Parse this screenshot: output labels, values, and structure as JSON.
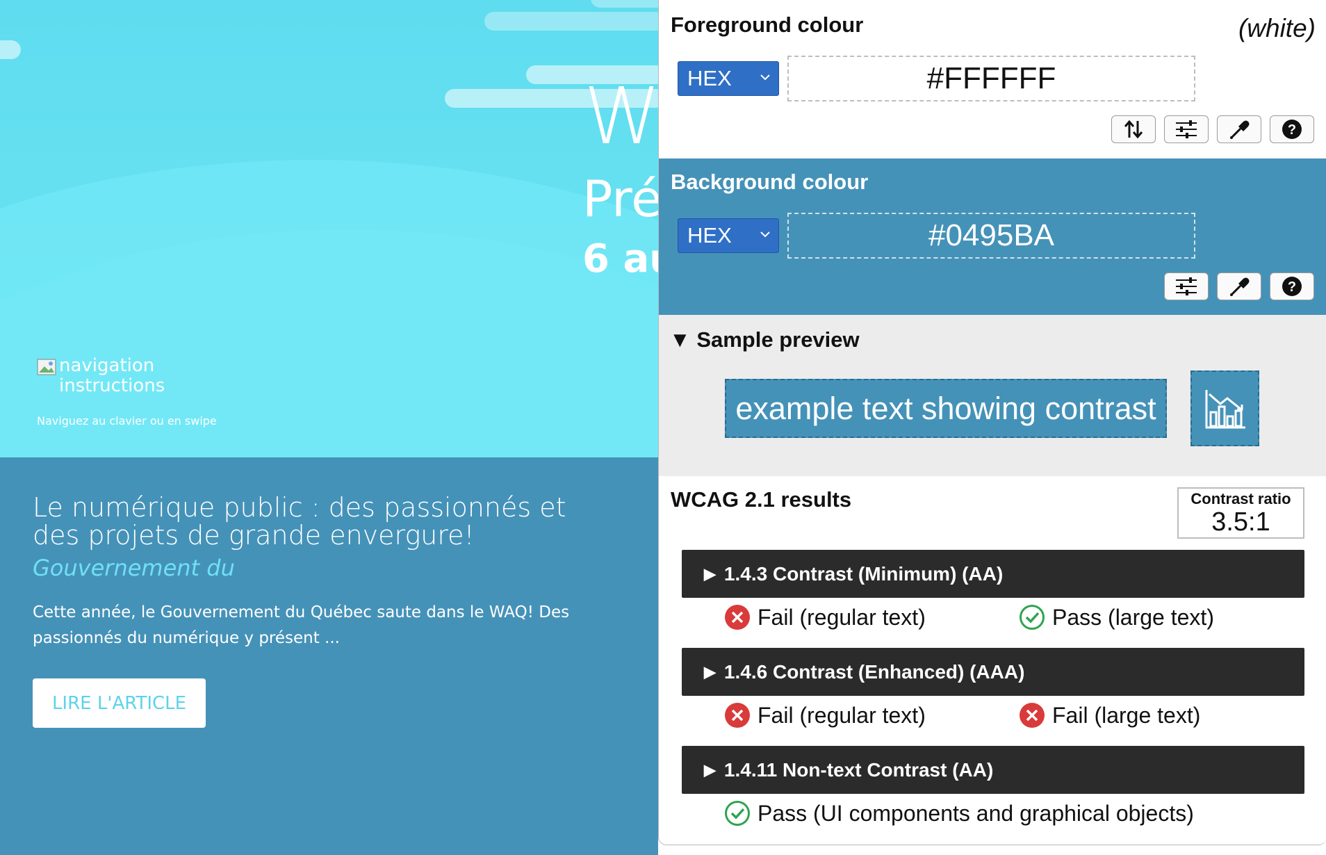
{
  "webpage": {
    "hero": {
      "title_fragment": "W",
      "subtitle_fragment": "Pré",
      "date_fragment": "6 au"
    },
    "nav_image_alt": "navigation instructions",
    "nav_hint": "Naviguez au clavier ou en swipe",
    "article": {
      "title": "Le numérique public : des passionnés et des projets de grande envergure!",
      "source": "Gouvernement du",
      "excerpt": "Cette année, le Gouvernement du Québec saute dans le WAQ! Des passionnés du numérique y présent ...",
      "button": "LIRE L'ARTICLE"
    },
    "colors": {
      "hero": "#66E2F2",
      "article_bg": "#4592B8",
      "accent": "#5CD3EA"
    }
  },
  "panel": {
    "foreground": {
      "heading": "Foreground colour",
      "name": "(white)",
      "format": "HEX",
      "value": "#FFFFFF",
      "tools": [
        "swap-icon",
        "sliders-icon",
        "eyedropper-icon",
        "help-icon"
      ]
    },
    "background": {
      "heading": "Background colour",
      "format": "HEX",
      "value": "#0495BA",
      "tools": [
        "sliders-icon",
        "eyedropper-icon",
        "help-icon"
      ]
    },
    "preview": {
      "heading": "Sample preview",
      "sample_text": "example text showing contrast",
      "graphic_icon": "chart-icon"
    },
    "results": {
      "heading": "WCAG 2.1 results",
      "ratio_label": "Contrast ratio",
      "ratio_value": "3.5:1",
      "criteria": [
        {
          "title": "1.4.3 Contrast (Minimum) (AA)",
          "results": [
            {
              "status": "fail",
              "label": "Fail (regular text)"
            },
            {
              "status": "pass",
              "label": "Pass (large text)"
            }
          ]
        },
        {
          "title": "1.4.6 Contrast (Enhanced) (AAA)",
          "results": [
            {
              "status": "fail",
              "label": "Fail (regular text)"
            },
            {
              "status": "fail",
              "label": "Fail (large text)"
            }
          ]
        },
        {
          "title": "1.4.11 Non-text Contrast (AA)",
          "results": [
            {
              "status": "pass",
              "label": "Pass (UI components and graphical objects)"
            }
          ]
        }
      ]
    },
    "colors": {
      "select": "#2F6FC6",
      "bg_section": "#4592B8",
      "criterion": "#2B2B2B",
      "pass": "#2EA44F",
      "fail": "#D93A3A"
    }
  }
}
